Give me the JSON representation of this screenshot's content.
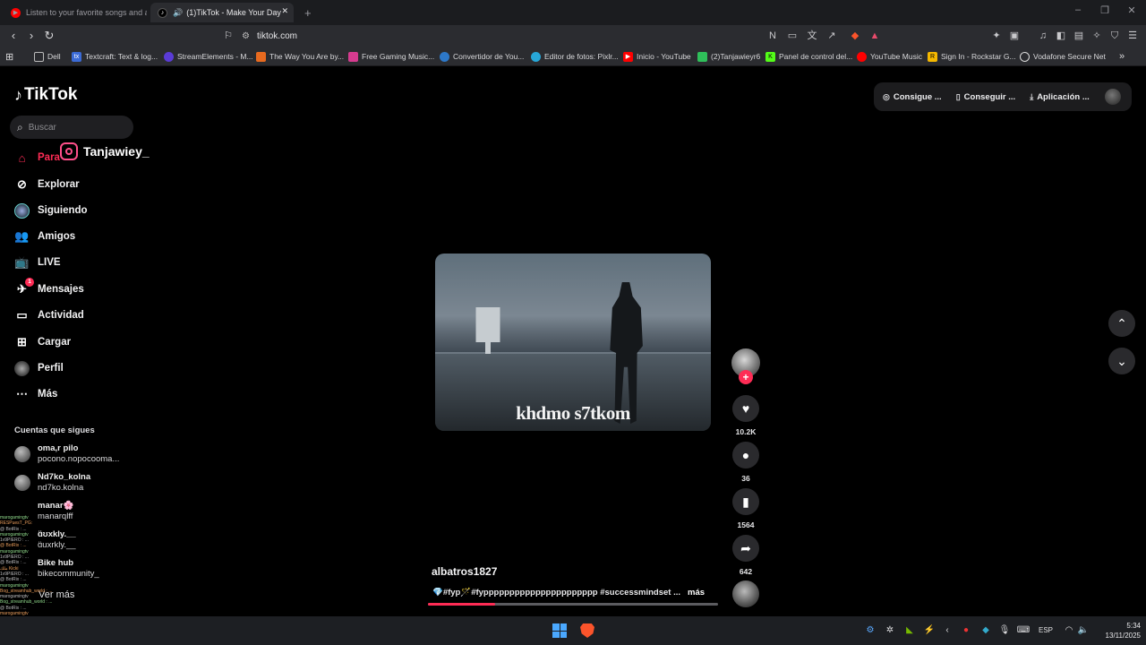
{
  "browser": {
    "tabs": [
      {
        "title": "Listen to your favorite songs and albu",
        "icon": "youtube-music-icon",
        "active": false
      },
      {
        "title": "(1)TikTok - Make Your Day",
        "icon": "tiktok-icon",
        "active": true
      }
    ],
    "url": "tiktok.com",
    "bookmarks": [
      {
        "label": "Dell",
        "icon": "folder-icon",
        "color": "#e6e6e6"
      },
      {
        "label": "Textcraft: Text & log...",
        "icon": "textcraft-icon",
        "color": "#3b6bd6"
      },
      {
        "label": "StreamElements - M...",
        "icon": "streamelements-icon",
        "color": "#5a3bd6"
      },
      {
        "label": "The Way You Are by...",
        "icon": "music-icon",
        "color": "#e86a1f"
      },
      {
        "label": "Free Gaming Music...",
        "icon": "gaming-music-icon",
        "color": "#d63b8f"
      },
      {
        "label": "Convertidor de You...",
        "icon": "converter-icon",
        "color": "#2d78c8"
      },
      {
        "label": "Editor de fotos: Pixlr...",
        "icon": "pixlr-icon",
        "color": "#27a7d8"
      },
      {
        "label": "Inicio - YouTube",
        "icon": "youtube-icon",
        "color": "#ff0000"
      },
      {
        "label": "(2)Tanjawieyr6",
        "icon": "puzzle-icon",
        "color": "#2fbf5a"
      },
      {
        "label": "Panel de control del...",
        "icon": "kick-icon",
        "color": "#53fc18"
      },
      {
        "label": "YouTube Music",
        "icon": "youtube-music-icon",
        "color": "#ff0000"
      },
      {
        "label": "Sign In - Rockstar G...",
        "icon": "rockstar-icon",
        "color": "#f5b800"
      },
      {
        "label": "Vodafone Secure Net",
        "icon": "vodafone-icon",
        "color": "#e60000"
      }
    ]
  },
  "tiktok": {
    "logo": "TikTok",
    "search_placeholder": "Buscar",
    "overlay_handle": "Tanjawiey_",
    "nav": [
      {
        "label": "Para",
        "icon": "home-icon",
        "active": true
      },
      {
        "label": "Explorar",
        "icon": "compass-icon"
      },
      {
        "label": "Siguiendo",
        "icon": "following-avatar-icon"
      },
      {
        "label": "Amigos",
        "icon": "friends-icon"
      },
      {
        "label": "LIVE",
        "icon": "live-tv-icon"
      },
      {
        "label": "Mensajes",
        "icon": "messages-icon",
        "badge": "1"
      },
      {
        "label": "Actividad",
        "icon": "activity-icon"
      },
      {
        "label": "Cargar",
        "icon": "upload-icon"
      },
      {
        "label": "Perfil",
        "icon": "profile-avatar-icon"
      },
      {
        "label": "Más",
        "icon": "more-dots-icon"
      }
    ],
    "following_title": "Cuentas que sigues",
    "following": [
      {
        "name": "oma,r pilo",
        "handle": "pocono.nopocooma..."
      },
      {
        "name": "Nd7ko_kolna",
        "handle": "nd7ko.kolna"
      },
      {
        "name": "manar🌸",
        "handle": "manarqlff"
      },
      {
        "name": "ɑ̈ʊxkly.__",
        "handle": "ɑ̈uxrkly.__"
      },
      {
        "name": "Bike hub",
        "handle": "bikecommunity_"
      }
    ],
    "see_more": "Ver más",
    "top_actions": [
      {
        "label": "Consigue ...",
        "icon": "coin-icon"
      },
      {
        "label": "Conseguir ...",
        "icon": "phone-icon"
      },
      {
        "label": "Aplicación ...",
        "icon": "download-icon"
      }
    ],
    "video": {
      "caption_overlay": "khdmo s7tkom",
      "author": "albatros1827",
      "description": "💎#fyp🪄#fypppppppppppppppppppppp #successmindset ...",
      "more_label": "más",
      "progress": 0.23,
      "likes": "10.2K",
      "comments": "36",
      "saves": "1564",
      "shares": "642"
    }
  },
  "chat_lines": [
    "marogamingtv",
    "RESPuesT_PG:",
    "@ BotRix : ... ",
    "marogamingtv",
    "1v9PIERO : ... ",
    "@ BotRix : ... ",
    "marogamingtv",
    "1v9PIERO : ... ",
    "@ BotRix : ... ",
    "ملك Kicki",
    "1v9PIERO : ... ",
    "@ BotRix : ... ",
    "marogamingtv",
    "Bog_streamhub_world : ...",
    "marogamingtv",
    "Bog_streamhub_world : ...",
    "@ BotRix : ... ",
    "marogamingtv"
  ],
  "taskbar": {
    "language": "ESP",
    "time": "5:34",
    "date": "13/11/2025"
  }
}
